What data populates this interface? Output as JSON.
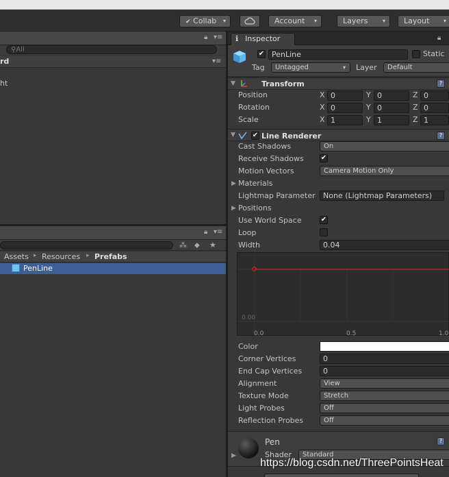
{
  "toolbar": {
    "collab_label": "Collab",
    "account_label": "Account",
    "layers_label": "Layers",
    "layout_label": "Layout",
    "arrow": "▾"
  },
  "hierarchy": {
    "search_placeholder": "All",
    "header_fragment": "rd",
    "item_fragment": "ht"
  },
  "project": {
    "breadcrumb": [
      "Assets",
      "Resources",
      "Prefabs"
    ],
    "breadcrumb_sep": "▸",
    "selected_item": "PenLine"
  },
  "inspector": {
    "tab_label": "Inspector",
    "object_name": "PenLine",
    "static_label": "Static",
    "tag_label": "Tag",
    "tag_value": "Untagged",
    "layer_label": "Layer",
    "layer_value": "Default",
    "transform": {
      "title": "Transform",
      "rows": [
        {
          "label": "Position",
          "x": "0",
          "y": "0",
          "z": "0"
        },
        {
          "label": "Rotation",
          "x": "0",
          "y": "0",
          "z": "0"
        },
        {
          "label": "Scale",
          "x": "1",
          "y": "1",
          "z": "1"
        }
      ],
      "axis_x": "X",
      "axis_y": "Y",
      "axis_z": "Z"
    },
    "line_renderer": {
      "title": "Line Renderer",
      "cast_shadows_label": "Cast Shadows",
      "cast_shadows_value": "On",
      "receive_shadows_label": "Receive Shadows",
      "motion_vectors_label": "Motion Vectors",
      "motion_vectors_value": "Camera Motion Only",
      "materials_label": "Materials",
      "lightmap_label": "Lightmap Parameter",
      "lightmap_value": "None (Lightmap Parameters)",
      "positions_label": "Positions",
      "use_world_space_label": "Use World Space",
      "loop_label": "Loop",
      "width_label": "Width",
      "width_value": "0.04",
      "curve_y_label": "0.00",
      "curve_x_labels": [
        "0.0",
        "0.5",
        "1.0"
      ],
      "color_label": "Color",
      "corner_vertices_label": "Corner Vertices",
      "corner_vertices_value": "0",
      "end_cap_label": "End Cap Vertices",
      "end_cap_value": "0",
      "alignment_label": "Alignment",
      "alignment_value": "View",
      "texture_mode_label": "Texture Mode",
      "texture_mode_value": "Stretch",
      "light_probes_label": "Light Probes",
      "light_probes_value": "Off",
      "reflection_probes_label": "Reflection Probes",
      "reflection_probes_value": "Off"
    },
    "material": {
      "name": "Pen",
      "shader_label": "Shader",
      "shader_value": "Standard"
    }
  },
  "watermark": "https://blog.csdn.net/ThreePointsHeat",
  "colors": {
    "accent_selection": "#3e5f96",
    "curve_line": "#d02020",
    "background": "#383838"
  }
}
